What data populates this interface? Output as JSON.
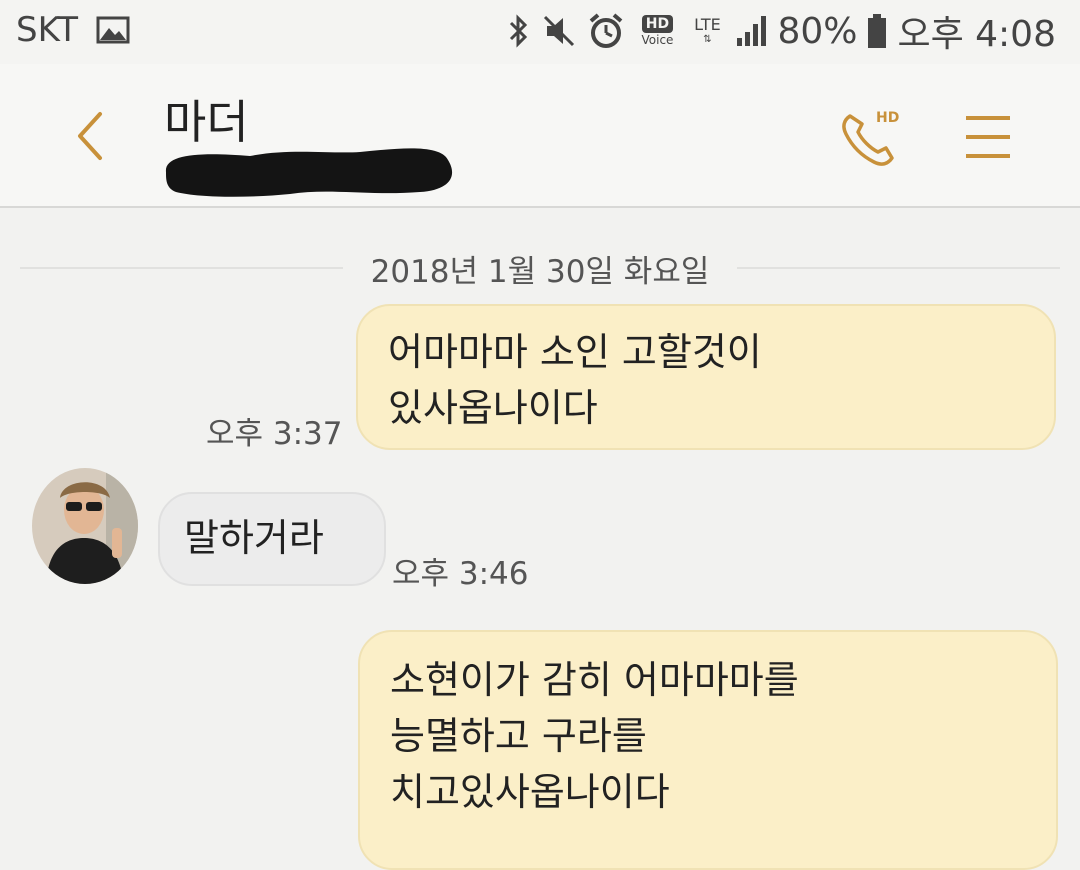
{
  "status_bar": {
    "carrier": "SKT",
    "battery": "80%",
    "time": "오후 4:08",
    "icons": [
      "gallery-icon",
      "bluetooth-icon",
      "mute-icon",
      "alarm-icon",
      "hd-voice-icon",
      "lte-icon",
      "signal-icon",
      "battery-icon"
    ],
    "hd_label": "HD",
    "voice_label": "Voice",
    "lte_label": "LTE"
  },
  "header": {
    "contact_name": "마더",
    "call_hd_label": "HD",
    "accent_color": "#c8913a"
  },
  "conversation": {
    "date": "2018년 1월 30일 화요일",
    "messages": [
      {
        "direction": "outgoing",
        "lines": [
          "어마마마 소인 고할것이",
          "있사옵나이다"
        ],
        "time": "오후 3:37"
      },
      {
        "direction": "incoming",
        "lines": [
          "말하거라"
        ],
        "time": "오후 3:46"
      },
      {
        "direction": "outgoing",
        "lines": [
          "소현이가 감히 어마마마를",
          "능멸하고 구라를",
          "치고있사옵나이다"
        ],
        "time": ""
      }
    ]
  },
  "colors": {
    "outgoing_bubble": "#fbefc8",
    "incoming_bubble": "#ececec",
    "background": "#f2f2f0"
  }
}
